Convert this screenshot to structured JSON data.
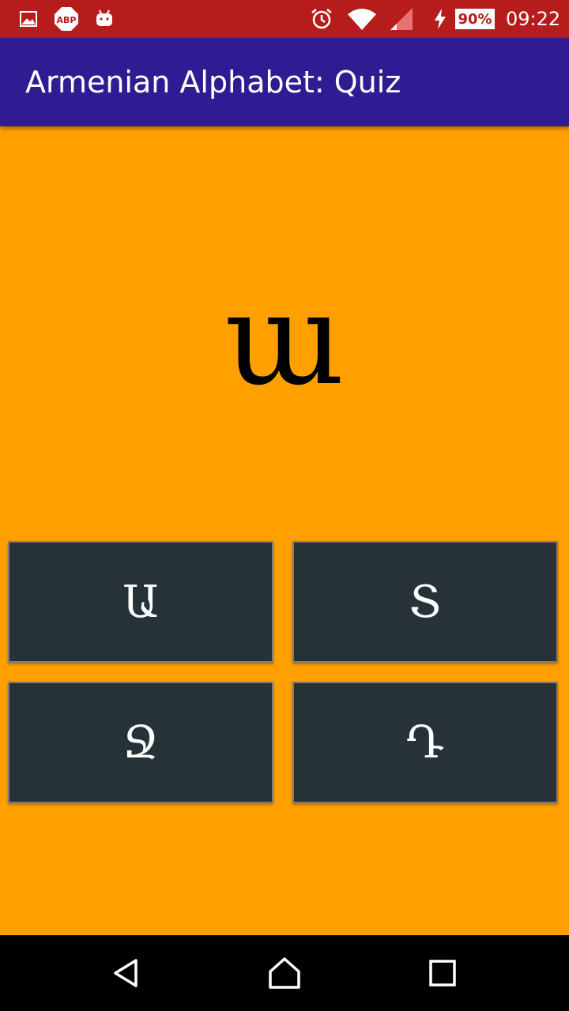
{
  "status_bar": {
    "color": "#B71C1C",
    "icons_left": [
      "image-notification-icon",
      "abp-icon",
      "android-notification-icon"
    ],
    "icons_right": [
      "alarm-icon",
      "wifi-icon",
      "signal-icon",
      "charging-icon"
    ],
    "battery": "90%",
    "time": "09:22"
  },
  "app_bar": {
    "title": "Armenian Alphabet: Quiz",
    "color": "#311B92"
  },
  "quiz": {
    "letter": "ա",
    "background": "#FF9F00",
    "answers": [
      {
        "label": "Ա"
      },
      {
        "label": "Տ"
      },
      {
        "label": "Ջ"
      },
      {
        "label": "Դ"
      }
    ],
    "button_color": "#263238"
  },
  "nav_bar": {
    "buttons": [
      "back-icon",
      "home-icon",
      "recents-icon"
    ]
  }
}
